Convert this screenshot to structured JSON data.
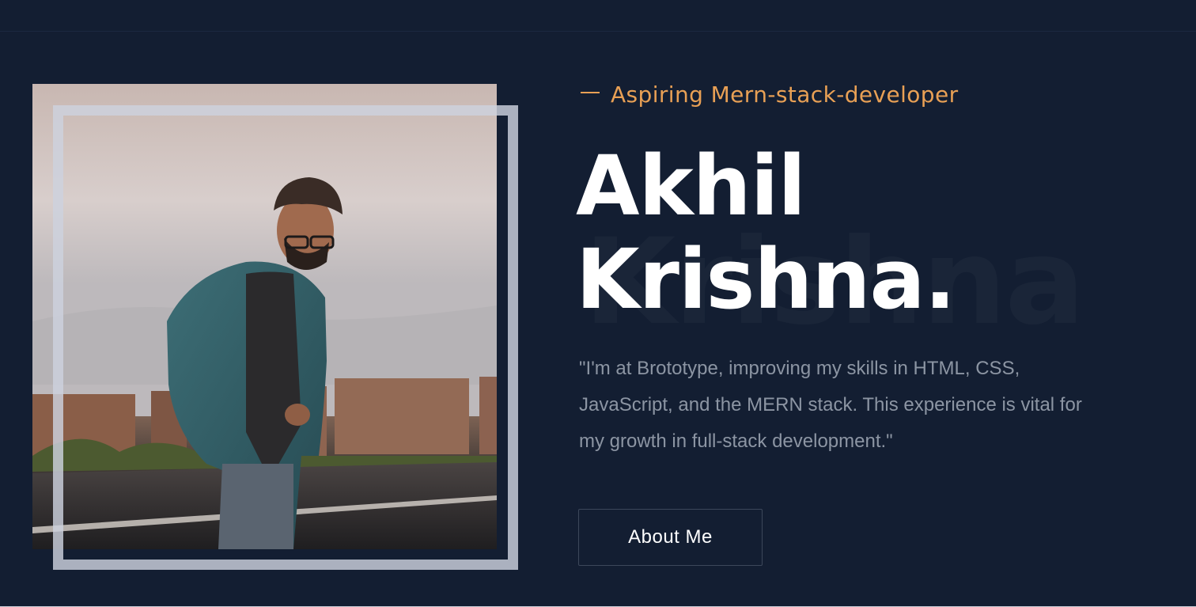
{
  "hero": {
    "tagline": "Aspiring Mern-stack-developer",
    "name_line1": "Akhil",
    "name_line2": "Krishna.",
    "background_word": "Krishna",
    "quote": "\"I'm at Brototype, improving my skills in HTML, CSS, JavaScript, and the MERN stack. This experience is vital for my growth in full-stack development.\"",
    "about_button_label": "About Me"
  },
  "colors": {
    "background": "#131e32",
    "accent": "#e8a055",
    "heading": "#ffffff",
    "body_text": "#8c95a3",
    "frame": "#cdd2de"
  }
}
